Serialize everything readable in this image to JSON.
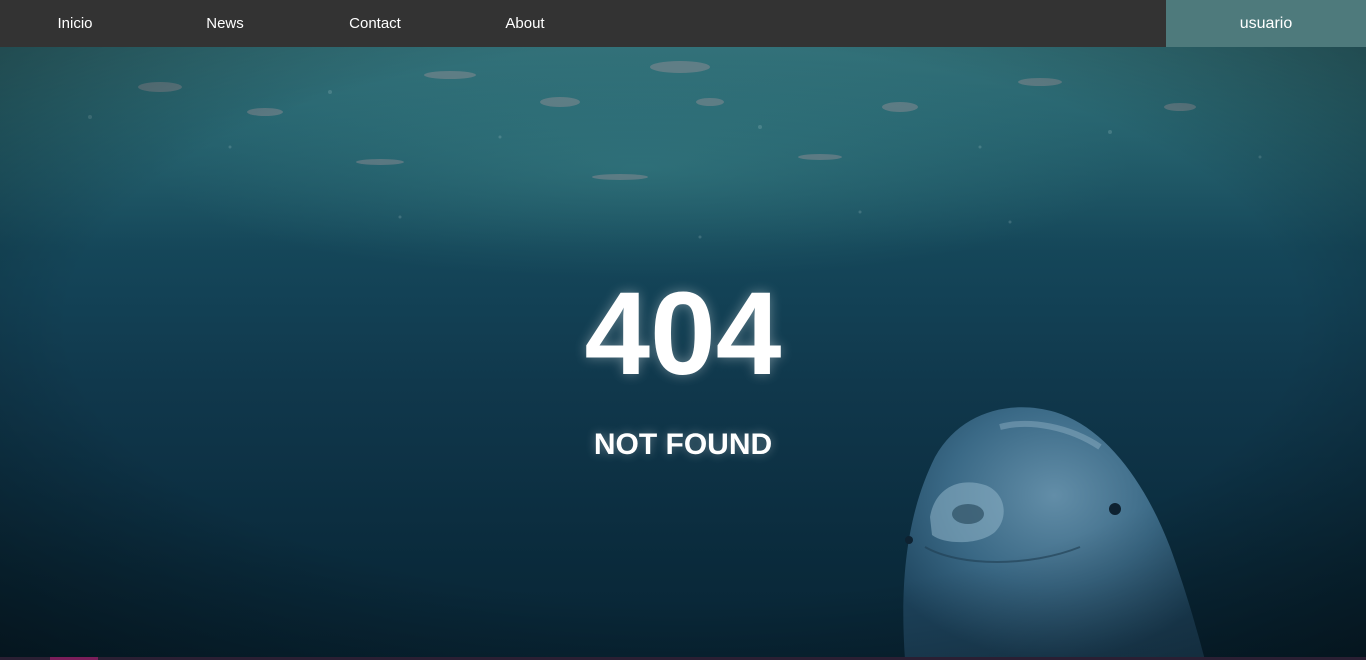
{
  "nav": {
    "items": [
      {
        "label": "Inicio"
      },
      {
        "label": "News"
      },
      {
        "label": "Contact"
      },
      {
        "label": "About"
      }
    ],
    "user_label": "usuario"
  },
  "error": {
    "code": "404",
    "message": "NOT FOUND"
  },
  "colors": {
    "navbar": "#333333",
    "user_tab": "#4e7a7c",
    "text": "#ffffff",
    "water_top": "#1f5b66",
    "water_bottom": "#082535"
  }
}
